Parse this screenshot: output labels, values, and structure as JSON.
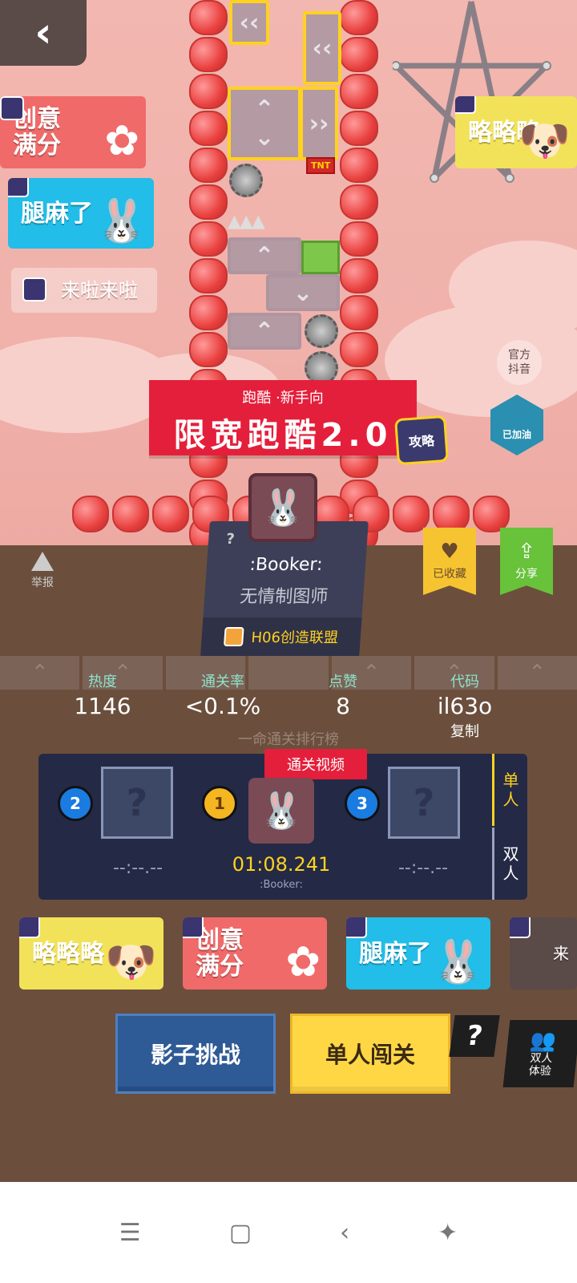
{
  "level": {
    "category": "跑酷 ·新手向",
    "title": "限宽跑酷2.0"
  },
  "floating_buttons": {
    "guide": "攻略",
    "official": "官方\n抖音",
    "joined": "已加油",
    "report": "举报",
    "favorite": "已收藏",
    "share": "分享"
  },
  "stickers_top": [
    {
      "text": "创意\n满分"
    },
    {
      "text": "腿麻了"
    },
    {
      "text": "来啦来啦"
    },
    {
      "text": "略略略"
    }
  ],
  "author": {
    "name": ":Booker:",
    "title": "无情制图师",
    "guild": "H06创造联盟",
    "unknown_mark": "?"
  },
  "stats": [
    {
      "label": "热度",
      "value": "1146"
    },
    {
      "label": "通关率",
      "value": "<0.1%"
    },
    {
      "label": "点赞",
      "value": "8"
    },
    {
      "label": "代码",
      "value": "il63o"
    }
  ],
  "copy_label": "复制",
  "leaderboard": {
    "title": "一命通关排行榜",
    "video_tag": "通关视频",
    "entries": [
      {
        "rank": "2",
        "time": "--:--.--"
      },
      {
        "rank": "1",
        "time": "01:08.241",
        "player": ":Booker:"
      },
      {
        "rank": "3",
        "time": "--:--.--"
      }
    ],
    "tabs": [
      "单\n人",
      "双\n人"
    ]
  },
  "stickers_bottom": [
    {
      "text": "略略略"
    },
    {
      "text": "创意\n满分"
    },
    {
      "text": "腿麻了"
    },
    {
      "text": "来"
    }
  ],
  "actions": {
    "shadow": "影子挑战",
    "solo": "单人闯关",
    "help": "?",
    "duo": "双人\n体验"
  },
  "nav": {
    "menu": "☰",
    "home": "▢",
    "back": "‹",
    "accessibility": "✦"
  },
  "back_arrow": "‹",
  "tnt": "TNT",
  "colors": {
    "banner_red": "#e41f3b",
    "fav_yellow": "#f6c431",
    "share_green": "#68c23a",
    "stat_label": "#8fe3c9",
    "time_gold": "#ffd21f"
  }
}
